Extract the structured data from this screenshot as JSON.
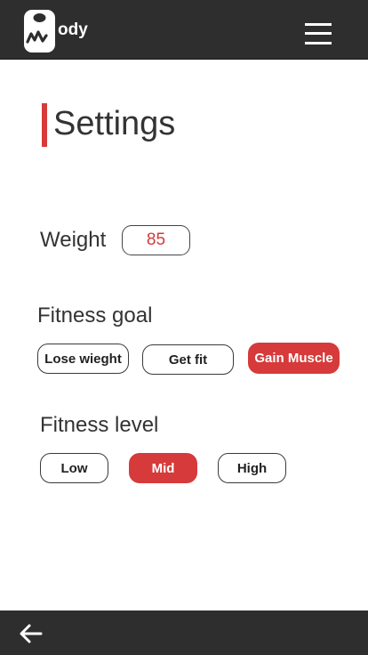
{
  "header": {
    "logo_text": "ody",
    "menu_icon": "hamburger-menu-icon"
  },
  "page": {
    "title": "Settings",
    "accent_color": "#d63a3a"
  },
  "weight": {
    "label": "Weight",
    "value": "85"
  },
  "fitness_goal": {
    "label": "Fitness goal",
    "options": [
      "Lose wieght",
      "Get fit",
      "Gain Muscle"
    ],
    "selected": "Gain Muscle"
  },
  "fitness_level": {
    "label": "Fitness level",
    "options": [
      "Low",
      "Mid",
      "High"
    ],
    "selected": "Mid"
  },
  "footer": {
    "back_icon": "arrow-left-icon"
  },
  "colors": {
    "bar_background": "#2e2e2e",
    "accent": "#d63a3a",
    "text": "#333333"
  }
}
